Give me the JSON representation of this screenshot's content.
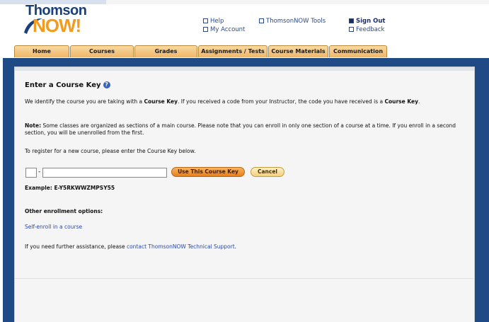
{
  "logo": {
    "line1": "Thomson",
    "line2": "NOW!"
  },
  "toplinks": {
    "help": "Help",
    "my_account": "My Account",
    "tools": "ThomsonNOW Tools",
    "sign_out": "Sign Out",
    "feedback": "Feedback"
  },
  "tabs": [
    "Home",
    "Courses",
    "Grades",
    "Assignments / Tests",
    "Course Materials",
    "Communication"
  ],
  "main": {
    "title": "Enter a Course Key",
    "intro_prefix": "We identify the course you are taking with a ",
    "intro_bold": "Course Key",
    "intro_mid": ". If you received a code from your Instructor, the code you have received is a ",
    "intro_bold2": "Course Key",
    "intro_end": ".",
    "note_label": "Note:",
    "note_text": " Some classes are organized as sections of a main course. Please note that you can enroll in only one section of a course at a time. If you enroll in a second section, you will be unenrolled from the first.",
    "register_text": "To register for a new course, please enter the Course Key below.",
    "key_prefix_value": "",
    "key_value": "",
    "dash": "-",
    "use_key_button": "Use This Course Key",
    "cancel_button": "Cancel",
    "example": "Example: E-Y5RKWWZMPSY55",
    "other_options_heading": "Other enrollment options:",
    "self_enroll_link": "Self-enroll in a course",
    "assist_prefix": "If you need further assistance, please ",
    "assist_link": "contact ThomsonNOW Technical Support",
    "assist_suffix": "."
  },
  "colors": {
    "frame_blue": "#1f4a86",
    "brand_orange": "#f29b1d",
    "brand_navy": "#1a3f7a",
    "button_orange": "#e5801d",
    "link_blue": "#2b4aa8"
  }
}
